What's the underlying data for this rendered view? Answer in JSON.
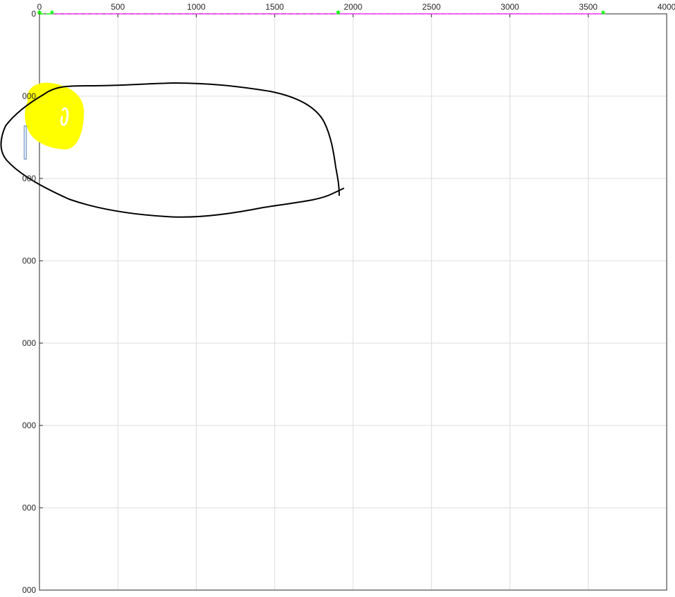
{
  "chart_data": {
    "type": "line",
    "title": "",
    "xlabel": "",
    "ylabel": "",
    "xlim": [
      0,
      4000
    ],
    "ylim": [
      0,
      3500
    ],
    "y_direction": "reversed",
    "x_axis_location": "top",
    "grid": true,
    "x_ticks": [
      0,
      500,
      1000,
      1500,
      2000,
      2500,
      3000,
      3500,
      4000
    ],
    "x_tick_labels": [
      "0",
      "500",
      "1000",
      "1500",
      "2000",
      "2500",
      "3000",
      "3500",
      "4000"
    ],
    "y_ticks": [
      0,
      500,
      1000,
      1500,
      2000,
      2500,
      3000,
      3500
    ],
    "y_tick_labels": [
      "0",
      "000",
      "000",
      "000",
      "000",
      "000",
      "000",
      "000"
    ],
    "colors": {
      "ellipse": "#ff0000",
      "dashed": "#00ff00",
      "diagonal": "#ff00ff",
      "annotation_stroke": "#000000",
      "highlight": "#ffff00",
      "grid": "#dcdcdc",
      "axes": "#262626"
    },
    "series": [
      {
        "kind": "ellipse",
        "center": [
          1905,
          0
        ],
        "radius_x": 1905,
        "radius_y": 0,
        "color": "#ff0000",
        "style": "solid"
      },
      {
        "kind": "line",
        "x": [
          0,
          0
        ],
        "y": [
          0,
          0
        ],
        "color": "#ff0000",
        "style": "solid",
        "marker": "*"
      },
      {
        "kind": "line",
        "x": [
          0,
          1905,
          1905
        ],
        "y": [
          0,
          0,
          0
        ],
        "color": "#00ff00",
        "style": "dashed",
        "marker": "*"
      },
      {
        "kind": "line",
        "x": [
          0,
          80,
          1905,
          3595
        ],
        "y": [
          0,
          0,
          0,
          0
        ],
        "color": "#00ff00",
        "style": "dashed",
        "marker": "*"
      },
      {
        "kind": "line",
        "x": [
          80,
          3595
        ],
        "y": [
          0,
          0
        ],
        "color": "#ff00ff",
        "style": "solid"
      }
    ]
  }
}
